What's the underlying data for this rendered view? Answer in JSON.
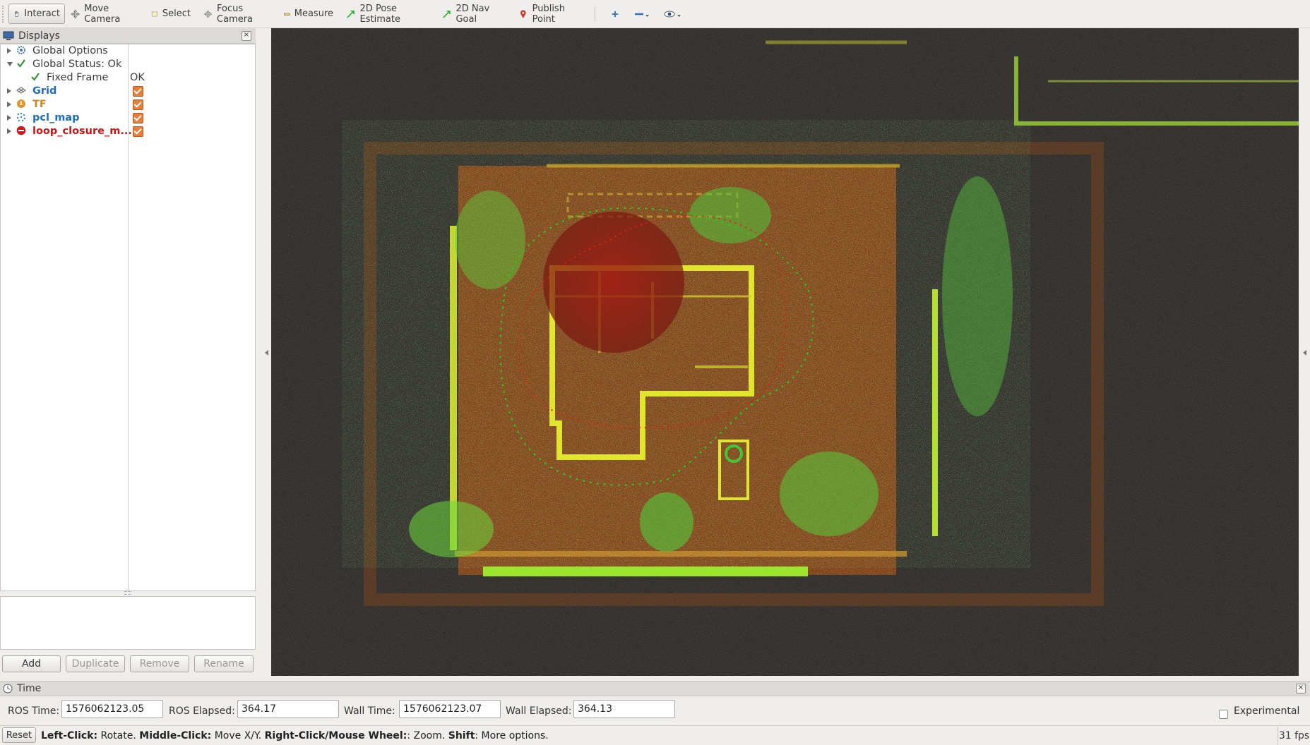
{
  "toolbar": {
    "interact": "Interact",
    "move_camera": "Move Camera",
    "select": "Select",
    "focus_camera": "Focus Camera",
    "measure": "Measure",
    "pose_estimate": "2D Pose Estimate",
    "nav_goal": "2D Nav Goal",
    "publish_point": "Publish Point"
  },
  "displays": {
    "title": "Displays",
    "items": [
      {
        "label": "Global Options",
        "value": "",
        "checked": null
      },
      {
        "label": "Global Status: Ok",
        "value": "",
        "checked": null
      },
      {
        "label": "Fixed Frame",
        "value": "OK",
        "checked": null
      },
      {
        "label": "Grid",
        "value": "",
        "checked": true
      },
      {
        "label": "TF",
        "value": "",
        "checked": true
      },
      {
        "label": "pcl_map",
        "value": "",
        "checked": true
      },
      {
        "label": "loop_closure_m...",
        "value": "",
        "checked": true
      }
    ],
    "buttons": {
      "add": "Add",
      "duplicate": "Duplicate",
      "remove": "Remove",
      "rename": "Rename"
    }
  },
  "time": {
    "title": "Time",
    "ros_time_label": "ROS Time:",
    "ros_time": "1576062123.05",
    "ros_elapsed_label": "ROS Elapsed:",
    "ros_elapsed": "364.17",
    "wall_time_label": "Wall Time:",
    "wall_time": "1576062123.07",
    "wall_elapsed_label": "Wall Elapsed:",
    "wall_elapsed": "364.13",
    "experimental": "Experimental"
  },
  "status": {
    "reset": "Reset",
    "left_click": "Left-Click:",
    "left_click_desc": " Rotate. ",
    "middle_click": "Middle-Click:",
    "middle_click_desc": " Move X/Y. ",
    "right_click": "Right-Click/Mouse Wheel:",
    "right_click_desc": ": Zoom. ",
    "shift": "Shift",
    "shift_desc": ": More options.",
    "fps": "31 fps"
  },
  "colors": {
    "accent": "#e57e38",
    "viewport_bg": "#303030",
    "cloud_orange": "#c2611f",
    "cloud_yellow": "#e8e62a",
    "cloud_green": "#4fc73a",
    "trajectory_green": "#1fd11f",
    "trajectory_red": "#e81d1d"
  }
}
